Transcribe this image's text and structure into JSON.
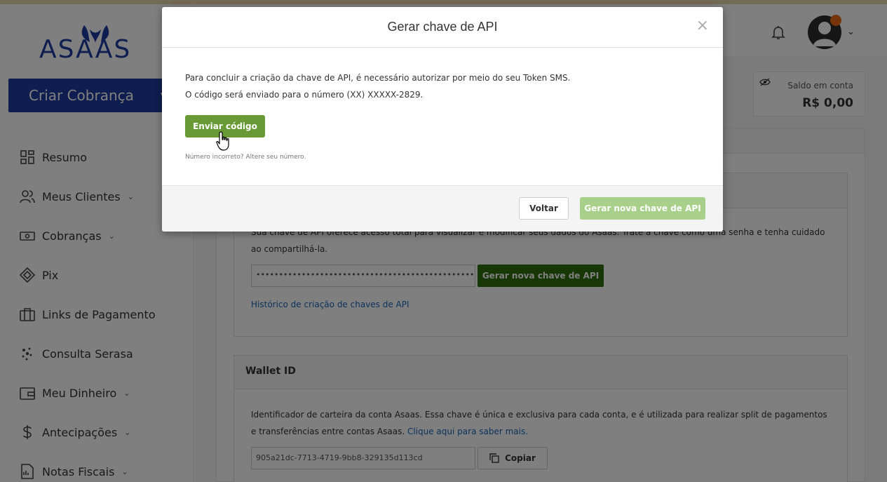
{
  "app": {
    "brand": "ASAAS"
  },
  "sidebar": {
    "create_label": "Criar Cobrança",
    "items": [
      {
        "label": "Resumo",
        "icon": "grid-icon",
        "has_submenu": false
      },
      {
        "label": "Meus Clientes",
        "icon": "users-icon",
        "has_submenu": true
      },
      {
        "label": "Cobranças",
        "icon": "money-icon",
        "has_submenu": true
      },
      {
        "label": "Pix",
        "icon": "pix-icon",
        "has_submenu": false
      },
      {
        "label": "Links de Pagamento",
        "icon": "briefcase-icon",
        "has_submenu": false
      },
      {
        "label": "Consulta Serasa",
        "icon": "dots-icon",
        "has_submenu": false
      },
      {
        "label": "Meu Dinheiro",
        "icon": "wallet-icon",
        "has_submenu": true
      },
      {
        "label": "Antecipações",
        "icon": "dollar-icon",
        "has_submenu": true
      },
      {
        "label": "Notas Fiscais",
        "icon": "invoice-icon",
        "has_submenu": true
      }
    ]
  },
  "header": {
    "balance_label": "Saldo em conta",
    "balance_value": "R$ 0,00"
  },
  "api_card": {
    "description": "Sua chave de API oferece acesso total para visualizar e modificar seus dados do Asaas. Trate a chave como uma senha e tenha cuidado ao compartilhá-la.",
    "key_masked": "••••••••••••••••••••••••••••••••••••••••••••••••••••••••••",
    "generate_label": "Gerar nova chave de API",
    "history_link": "Histórico de criação de chaves de API"
  },
  "wallet_card": {
    "title": "Wallet ID",
    "description": "Identificador de carteira da conta Asaas. Essa chave é única e exclusiva para cada conta, e é utilizada para realizar split de pagamentos e transferências entre contas Asaas.",
    "link": "Clique aqui para saber mais.",
    "wallet_id": "905a21dc-7713-4719-9bb8-329135d113cd",
    "copy_label": "Copiar"
  },
  "modal": {
    "title": "Gerar chave de API",
    "close_symbol": "×",
    "line1": "Para concluir a criação da chave de API, é necessário autorizar por meio do seu Token SMS.",
    "line2": "O código será enviado para o número (XX) XXXXX-2829.",
    "send_label": "Enviar código",
    "hint": "Número incorreto? Altere seu número.",
    "back_label": "Voltar",
    "generate_label": "Gerar nova chave de API"
  },
  "colors": {
    "primary_blue": "#1f3ca0",
    "send_green": "#6a9a35",
    "disabled_green": "#a8d08a",
    "dark_green": "#2f6f0f",
    "link_blue": "#1a66b8"
  }
}
